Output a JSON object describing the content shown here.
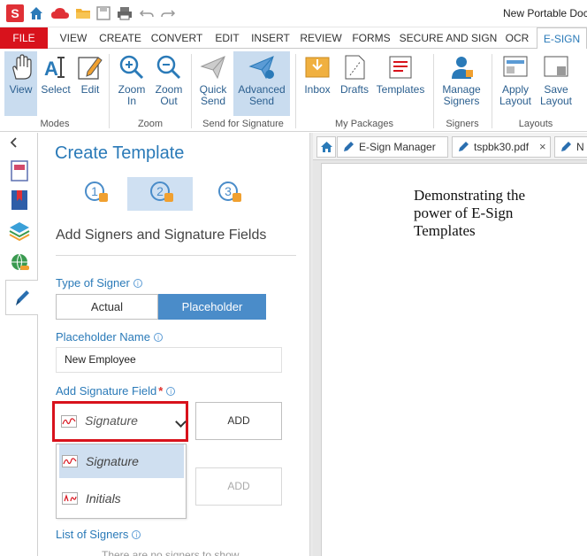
{
  "window": {
    "title": "New Portable Docu"
  },
  "ribbon_tabs": [
    {
      "label": "FILE"
    },
    {
      "label": "VIEW"
    },
    {
      "label": "CREATE"
    },
    {
      "label": "CONVERT"
    },
    {
      "label": "EDIT"
    },
    {
      "label": "INSERT"
    },
    {
      "label": "REVIEW"
    },
    {
      "label": "FORMS"
    },
    {
      "label": "SECURE AND SIGN"
    },
    {
      "label": "OCR"
    },
    {
      "label": "E-SIGN"
    }
  ],
  "ribbon": {
    "view": "View",
    "select": "Select",
    "edit": "Edit",
    "zoom_in": "Zoom\nIn",
    "zoom_out": "Zoom\nOut",
    "quick_send": "Quick\nSend",
    "advanced_send": "Advanced\nSend",
    "inbox": "Inbox",
    "drafts": "Drafts",
    "templates": "Templates",
    "manage_signers": "Manage\nSigners",
    "apply_layout": "Apply\nLayout",
    "save_layout": "Save\nLayout",
    "groups": {
      "modes": "Modes",
      "zoom": "Zoom",
      "send_for_signature": "Send for Signature",
      "my_packages": "My Packages",
      "signers": "Signers",
      "layouts": "Layouts"
    }
  },
  "panel": {
    "title": "Create Template",
    "steps": [
      "1",
      "2",
      "3"
    ],
    "section_title": "Add Signers and Signature Fields",
    "type_of_signer_label": "Type of Signer",
    "signer_options": {
      "actual": "Actual",
      "placeholder": "Placeholder"
    },
    "placeholder_name_label": "Placeholder Name",
    "placeholder_name_value": "New Employee",
    "add_signature_field_label": "Add Signature Field",
    "required_mark": "*",
    "selected_field": "Signature",
    "add_button": "ADD",
    "dropdown_options": [
      "Signature",
      "Initials"
    ],
    "list_of_signers_label": "List of Signers",
    "no_signers_text": "There are no signers to show"
  },
  "document": {
    "tabs": [
      {
        "label": "E-Sign Manager"
      },
      {
        "label": "tspbk30.pdf",
        "close": "×"
      },
      {
        "label": "N"
      }
    ],
    "page_text": "Demonstrating the power of E-Sign Templates"
  },
  "colors": {
    "accent": "#2a7ab8",
    "file_tab": "#d8121c",
    "selected": "#4a8cc9",
    "highlight_border": "#d8121c"
  }
}
